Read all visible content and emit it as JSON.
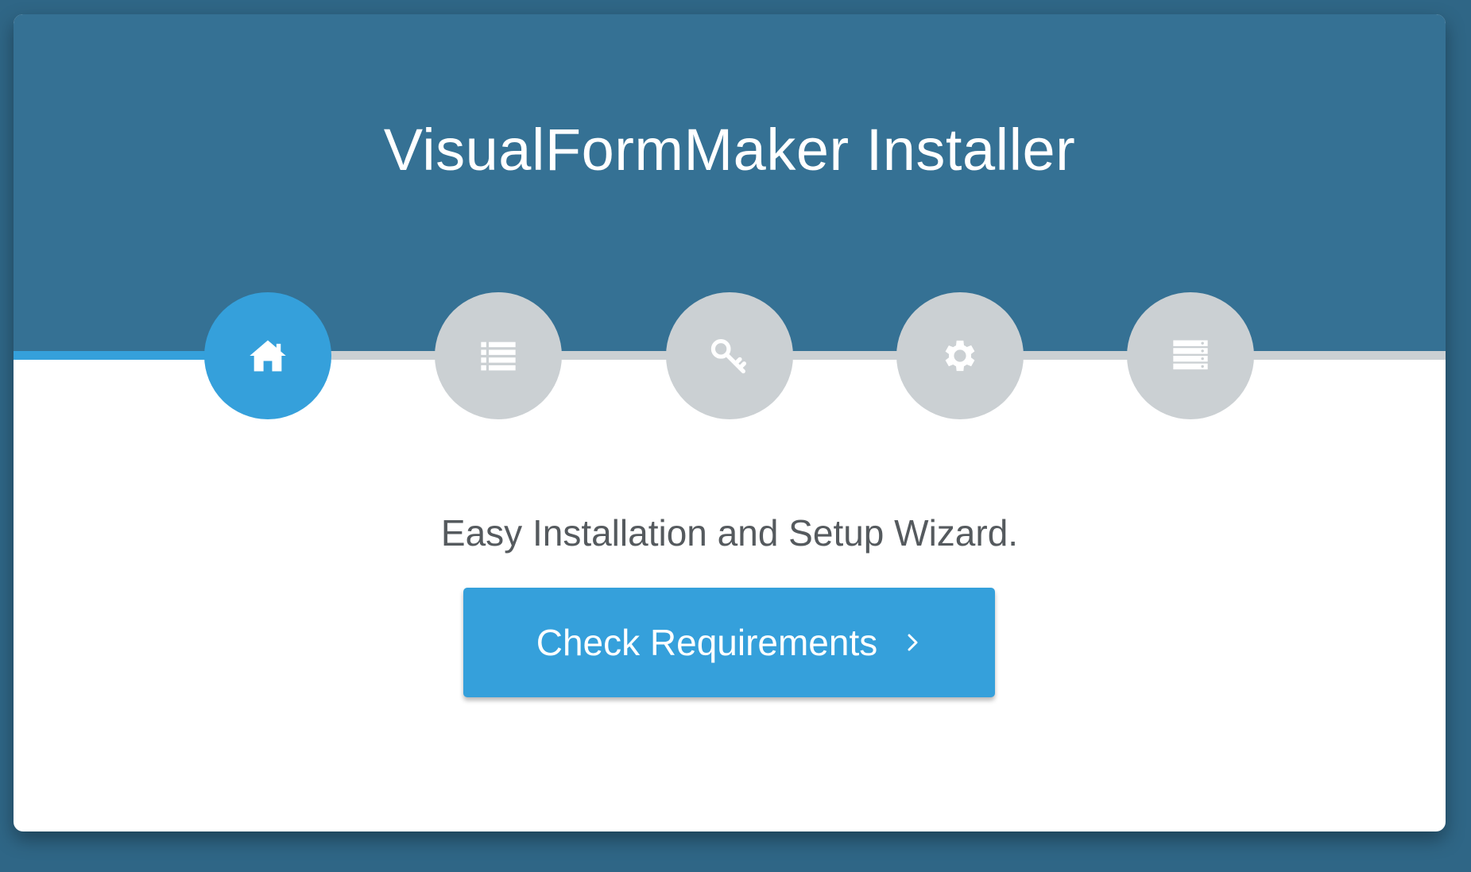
{
  "header": {
    "title": "VisualFormMaker Installer"
  },
  "steps": [
    {
      "icon": "home-icon",
      "active": true
    },
    {
      "icon": "list-icon",
      "active": false
    },
    {
      "icon": "key-icon",
      "active": false
    },
    {
      "icon": "gear-icon",
      "active": false
    },
    {
      "icon": "server-icon",
      "active": false
    }
  ],
  "progress": {
    "current_step": 1,
    "total_steps": 5
  },
  "main": {
    "subtitle": "Easy Installation and Setup Wizard.",
    "button_label": "Check Requirements"
  },
  "colors": {
    "background": "#2f6686",
    "header": "#357194",
    "accent": "#35a0db",
    "inactive_step": "#cbd0d3",
    "text": "#555a5e"
  }
}
